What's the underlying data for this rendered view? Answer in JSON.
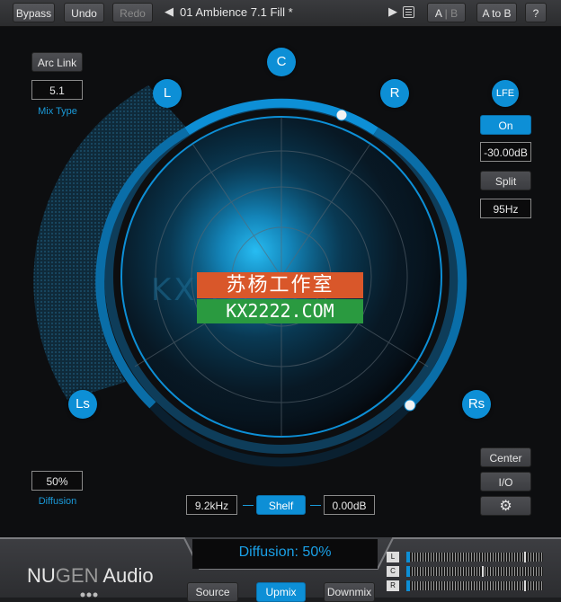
{
  "toolbar": {
    "bypass": "Bypass",
    "undo": "Undo",
    "redo": "Redo",
    "prev_arrow": "◀",
    "preset_name": "01 Ambience 7.1 Fill *",
    "next_arrow": "▶",
    "ab_a": "A",
    "ab_sep": "|",
    "ab_b": "B",
    "a_to_b": "A to B",
    "help": "?"
  },
  "left_panel": {
    "arc_link": "Arc Link",
    "mix_type_value": "5.1",
    "mix_type_label": "Mix Type",
    "diffusion_value": "50%",
    "diffusion_label": "Diffusion"
  },
  "speakers": {
    "c": "C",
    "l": "L",
    "r": "R",
    "ls": "Ls",
    "rs": "Rs",
    "lfe": "LFE"
  },
  "right_panel": {
    "lfe_on": "On",
    "lfe_gain": "-30.00dB",
    "split": "Split",
    "split_freq": "95Hz",
    "center": "Center",
    "io": "I/O"
  },
  "filter": {
    "frequency": "9.2kHz",
    "type": "Shelf",
    "gain": "0.00dB"
  },
  "watermark": {
    "ghost": "KX      .COM",
    "line1": "苏杨工作室",
    "line2": "KX2222.COM"
  },
  "bottom": {
    "logo_nu": "NU",
    "logo_gen": "GEN",
    "logo_audio": " Audio",
    "diffusion_display": "Diffusion: 50%",
    "source": "Source",
    "upmix": "Upmix",
    "downmix": "Downmix",
    "meters": [
      {
        "label": "L",
        "peak": 0.86,
        "level": 0.02
      },
      {
        "label": "C",
        "peak": 0.55,
        "level": 0.02
      },
      {
        "label": "R",
        "peak": 0.86,
        "level": 0.02
      }
    ]
  },
  "colors": {
    "accent": "#0d8fd6",
    "panel": "#0d0e10",
    "watermark_red": "#d9572a",
    "watermark_green": "#2a9a40"
  },
  "icons": {
    "prev": "triangle-left-icon",
    "next": "triangle-right-icon",
    "preset_list": "list-icon",
    "settings": "gear-icon"
  }
}
